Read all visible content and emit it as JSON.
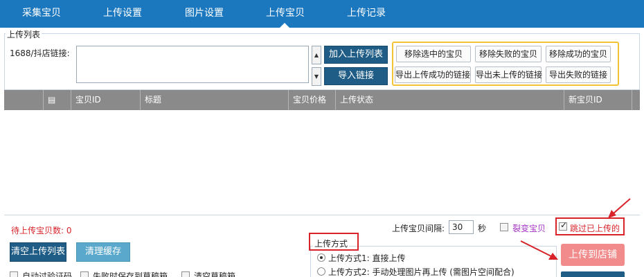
{
  "nav": {
    "tabs": [
      {
        "label": "采集宝贝"
      },
      {
        "label": "上传设置"
      },
      {
        "label": "图片设置"
      },
      {
        "label": "上传宝贝"
      },
      {
        "label": "上传记录"
      }
    ],
    "active_index": 3
  },
  "upload_list": {
    "legend": "上传列表",
    "url_label": "1688/抖店链接:",
    "url_value": "",
    "add_button": "加入上传列表",
    "import_button": "导入链接"
  },
  "actions": {
    "remove_selected": "移除选中的宝贝",
    "remove_failed": "移除失败的宝贝",
    "remove_success": "移除成功的宝贝",
    "export_success": "导出上传成功的链接",
    "export_not_uploaded": "导出未上传的链接",
    "export_failed": "导出失败的链接"
  },
  "table": {
    "columns": [
      "",
      "",
      "宝贝ID",
      "标题",
      "宝贝价格",
      "上传状态",
      "新宝贝ID"
    ],
    "rows": []
  },
  "bottom": {
    "pending_label": "待上传宝贝数:",
    "pending_count": "0",
    "interval_label": "上传宝贝间隔:",
    "interval_value": "30",
    "interval_unit": "秒",
    "split_label": "裂变宝贝",
    "split_checked": false,
    "skip_label": "跳过已上传的",
    "skip_checked": true,
    "clear_list_button": "清空上传列表",
    "clear_cache_button": "清理缓存",
    "upload_mode_title": "上传方式",
    "mode1": "上传方式1: 直接上传",
    "mode2": "上传方式2: 手动处理图片再上传 (需图片空间配合)",
    "mode_selected": 1,
    "upload_button": "上传到店铺",
    "auto_captcha": "自动过验证码",
    "save_draft": "失败时保存到草稿箱",
    "clear_draft": "清空草稿箱"
  },
  "colors": {
    "nav_bg": "#1b78bf",
    "primary_button": "#1f5d86",
    "light_button": "#5aa9cc",
    "highlight_yellow": "#f1c232",
    "alert_red": "#d8232a",
    "upload_button": "#f28c8c",
    "table_header": "#8a8a8a",
    "split_text": "#a334c4"
  }
}
